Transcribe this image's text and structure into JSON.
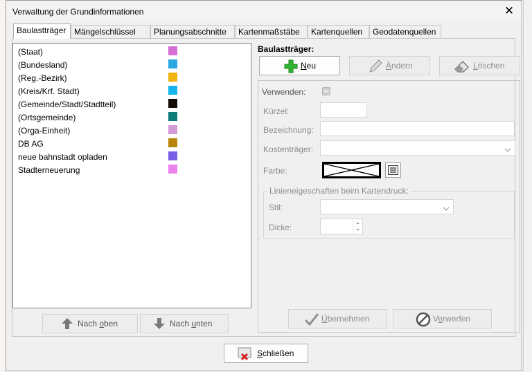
{
  "window": {
    "title": "Verwaltung der Grundinformationen",
    "close_glyph": "✕"
  },
  "tabs": [
    {
      "label": "Baulastträger"
    },
    {
      "label": "Mängelschlüssel"
    },
    {
      "label": "Planungsabschnitte"
    },
    {
      "label": "Kartenmaßstäbe"
    },
    {
      "label": "Kartenquellen"
    },
    {
      "label": "Geodatenquellen"
    }
  ],
  "list": {
    "items": [
      {
        "label": "(Staat)",
        "color": "#d56fd5"
      },
      {
        "label": "(Bundesland)",
        "color": "#2aa6e0"
      },
      {
        "label": "(Reg.-Bezirk)",
        "color": "#f2b40f"
      },
      {
        "label": "(Kreis/Krf. Stadt)",
        "color": "#15b6ee"
      },
      {
        "label": "(Gemeinde/Stadt/Stadtteil)",
        "color": "#120b07"
      },
      {
        "label": "(Ortsgemeinde)",
        "color": "#0f7c7c"
      },
      {
        "label": "(Orga-Einheit)",
        "color": "#d49ad8"
      },
      {
        "label": "DB AG",
        "color": "#b8860b"
      },
      {
        "label": "neue bahnstadt opladen",
        "color": "#7b5ee8"
      },
      {
        "label": "Stadterneuerung",
        "color": "#ee82ee"
      }
    ],
    "up_button": {
      "prefix": "Nach ",
      "accel": "o",
      "rest": "ben"
    },
    "down_button": {
      "prefix": "Nach ",
      "accel": "u",
      "rest": "nten"
    }
  },
  "detail": {
    "section_title": "Baulastträger:",
    "new_button": {
      "accel": "N",
      "rest": "eu"
    },
    "edit_button": {
      "accel": "Ä",
      "rest": "ndern"
    },
    "delete_button": {
      "accel": "L",
      "rest": "öschen"
    },
    "fields": {
      "verwenden": "Verwenden:",
      "kuerzel": "Kürzel:",
      "bezeichnung": "Bezeichnung:",
      "kostentraeger": "Kostenträger:",
      "farbe": "Farbe:",
      "linien_group": "Linieneigeschaften beim Kartendruck:",
      "stil": "Stil:",
      "dicke": "Dicke:"
    },
    "apply_button": {
      "accel": "Ü",
      "rest": "bernehmen"
    },
    "discard_button": {
      "prefix": "V",
      "accel": "e",
      "rest": "rwerfen"
    }
  },
  "footer": {
    "close_button": {
      "accel": "S",
      "rest": "chließen"
    }
  },
  "colors": {
    "accent_green": "#2fb52f",
    "dialog_bg": "#f0f0f0"
  },
  "icons": [
    "close-icon",
    "plus-icon",
    "pencil-icon",
    "eraser-icon",
    "arrow-up-icon",
    "arrow-down-icon",
    "checkmark-icon",
    "no-entry-icon",
    "close-door-icon",
    "color-picker-icon"
  ]
}
